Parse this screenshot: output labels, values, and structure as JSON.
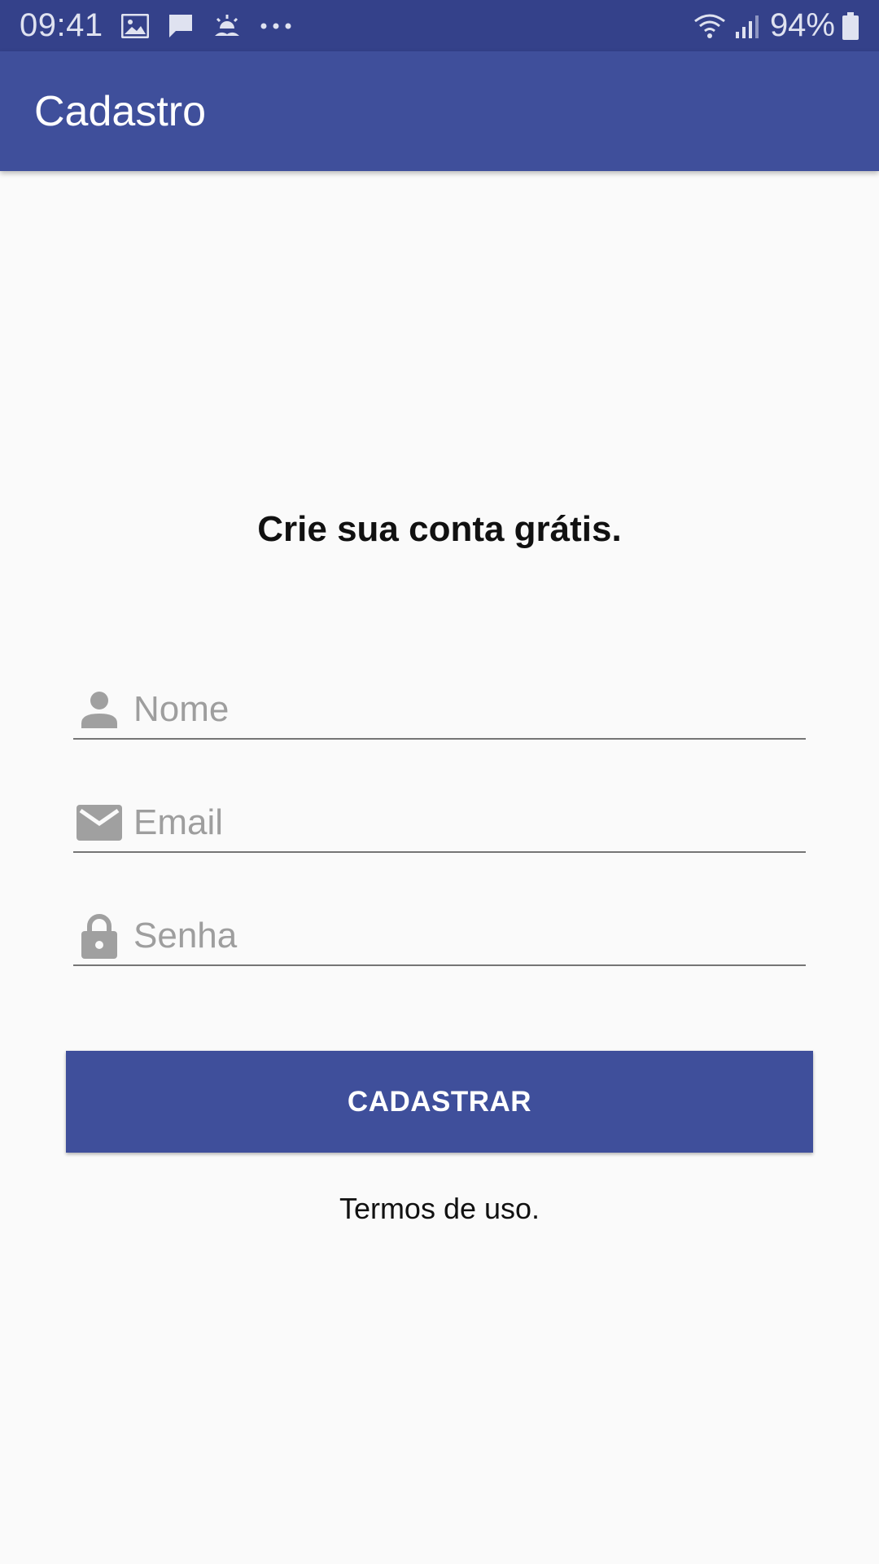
{
  "status_bar": {
    "time": "09:41",
    "battery_percent": "94%",
    "icons": [
      "image-icon",
      "message-icon",
      "weather-icon",
      "more-dots-icon",
      "wifi-icon",
      "signal-icon",
      "battery-icon"
    ]
  },
  "app_bar": {
    "title": "Cadastro",
    "color": "#3f4f9b"
  },
  "form": {
    "heading": "Crie sua conta grátis.",
    "fields": [
      {
        "placeholder": "Nome",
        "value": "",
        "icon": "person-icon"
      },
      {
        "placeholder": "Email",
        "value": "",
        "icon": "email-icon"
      },
      {
        "placeholder": "Senha",
        "value": "",
        "icon": "lock-icon"
      }
    ],
    "submit_label": "CADASTRAR",
    "terms_label": "Termos de uso."
  },
  "colors": {
    "primary": "#3f4f9b",
    "primary_dark": "#34418a",
    "background": "#fafafa",
    "icon_gray": "#a0a0a0"
  }
}
